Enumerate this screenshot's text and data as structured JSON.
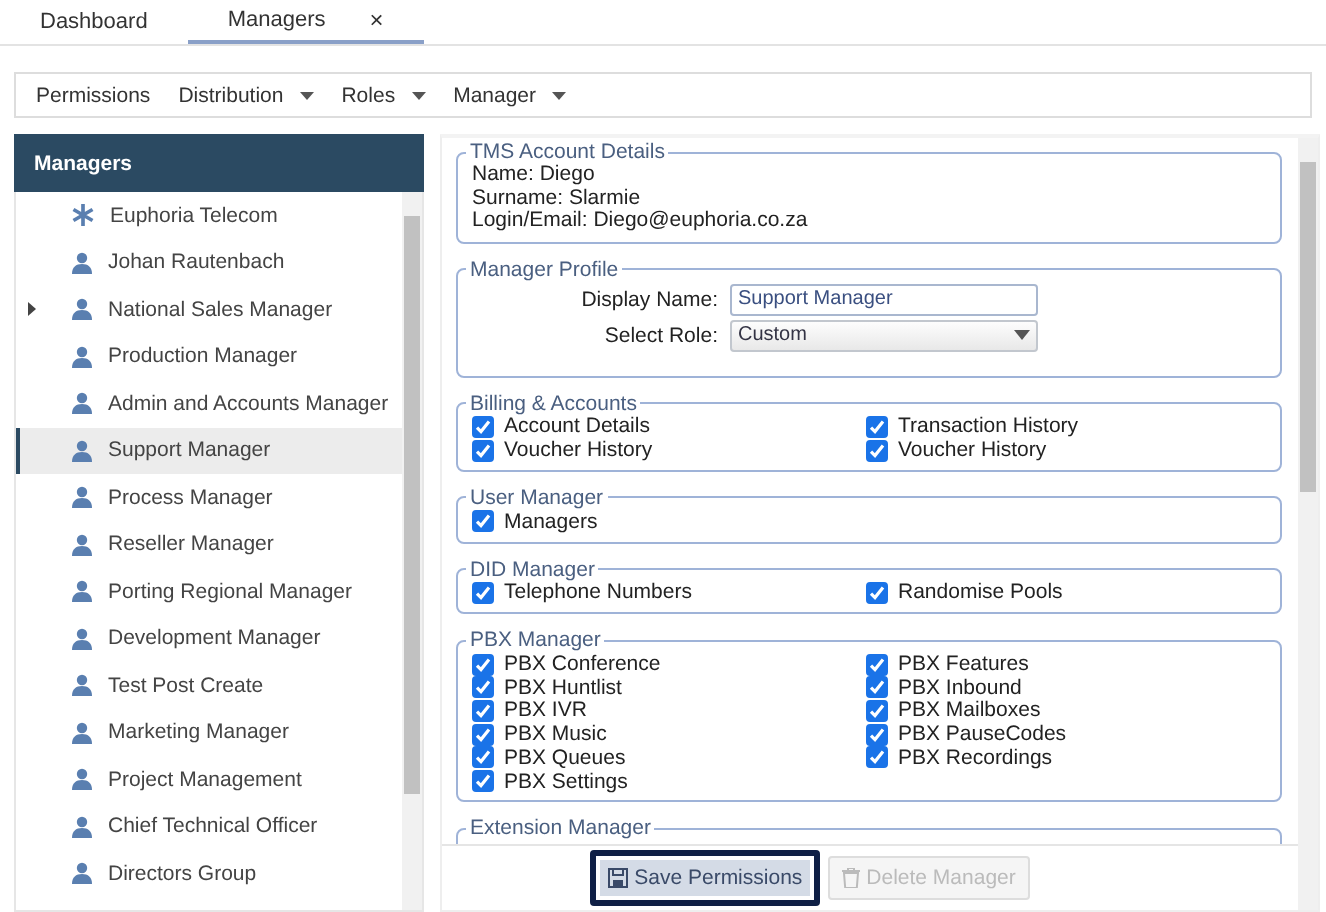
{
  "tabs": [
    {
      "label": "Dashboard",
      "selected": false
    },
    {
      "label": "Managers",
      "selected": true,
      "close_glyph": "×"
    }
  ],
  "toolbar": [
    {
      "label": "Permissions",
      "dropdown": false
    },
    {
      "label": "Distribution",
      "dropdown": true
    },
    {
      "label": "Roles",
      "dropdown": true
    },
    {
      "label": "Manager",
      "dropdown": true
    }
  ],
  "sidebar": {
    "title": "Managers",
    "items": [
      {
        "label": "Euphoria Telecom",
        "kind": "asterisk",
        "selected": false
      },
      {
        "label": "Johan Rautenbach",
        "kind": "user",
        "selected": false
      },
      {
        "label": "National Sales Manager",
        "kind": "user",
        "selected": false,
        "expanded": false
      },
      {
        "label": "Production Manager",
        "kind": "user",
        "selected": false
      },
      {
        "label": "Admin and Accounts Manager",
        "kind": "user",
        "selected": false
      },
      {
        "label": "Support Manager",
        "kind": "user",
        "selected": true
      },
      {
        "label": "Process Manager",
        "kind": "user",
        "selected": false
      },
      {
        "label": "Reseller Manager",
        "kind": "user",
        "selected": false
      },
      {
        "label": "Porting Regional Manager",
        "kind": "user",
        "selected": false
      },
      {
        "label": "Development Manager",
        "kind": "user",
        "selected": false
      },
      {
        "label": "Test Post Create",
        "kind": "user",
        "selected": false
      },
      {
        "label": "Marketing Manager",
        "kind": "user",
        "selected": false
      },
      {
        "label": "Project Management",
        "kind": "user",
        "selected": false
      },
      {
        "label": "Chief Technical Officer",
        "kind": "user",
        "selected": false
      },
      {
        "label": "Directors Group",
        "kind": "user",
        "selected": false
      }
    ]
  },
  "account": {
    "title": "TMS Account Details",
    "lines": [
      "Name: Diego",
      "Surname: Slarmie",
      "Login/Email: Diego@euphoria.co.za"
    ]
  },
  "profile": {
    "title": "Manager Profile",
    "fields": [
      {
        "label": "Display Name:",
        "kind": "text",
        "value": "Support Manager"
      },
      {
        "label": "Select Role:",
        "kind": "select",
        "value": "Custom"
      }
    ]
  },
  "groups": [
    {
      "title": "Billing & Accounts",
      "items": [
        {
          "label": "Account Details",
          "checked": true
        },
        {
          "label": "Transaction History",
          "checked": true
        },
        {
          "label": "Voucher History",
          "checked": true
        },
        {
          "label": "Voucher History",
          "checked": true
        }
      ]
    },
    {
      "title": "User Manager",
      "items": [
        {
          "label": "Managers",
          "checked": true
        }
      ]
    },
    {
      "title": "DID Manager",
      "items": [
        {
          "label": "Telephone Numbers",
          "checked": true
        },
        {
          "label": "Randomise Pools",
          "checked": true
        }
      ]
    },
    {
      "title": "PBX Manager",
      "items": [
        {
          "label": "PBX Conference",
          "checked": true
        },
        {
          "label": "PBX Features",
          "checked": true
        },
        {
          "label": "PBX Huntlist",
          "checked": true
        },
        {
          "label": "PBX Inbound",
          "checked": true
        },
        {
          "label": "PBX IVR",
          "checked": true
        },
        {
          "label": "PBX Mailboxes",
          "checked": true
        },
        {
          "label": "PBX Music",
          "checked": true
        },
        {
          "label": "PBX PauseCodes",
          "checked": true
        },
        {
          "label": "PBX Queues",
          "checked": true
        },
        {
          "label": "PBX Recordings",
          "checked": true
        },
        {
          "label": "PBX Settings",
          "checked": true
        }
      ]
    },
    {
      "title": "Extension Manager"
    }
  ],
  "buttons": [
    {
      "label": "Save Permissions",
      "kind": "save",
      "disabled": false,
      "focused": true
    },
    {
      "label": "Delete Manager",
      "kind": "delete",
      "disabled": true,
      "focused": false
    }
  ]
}
